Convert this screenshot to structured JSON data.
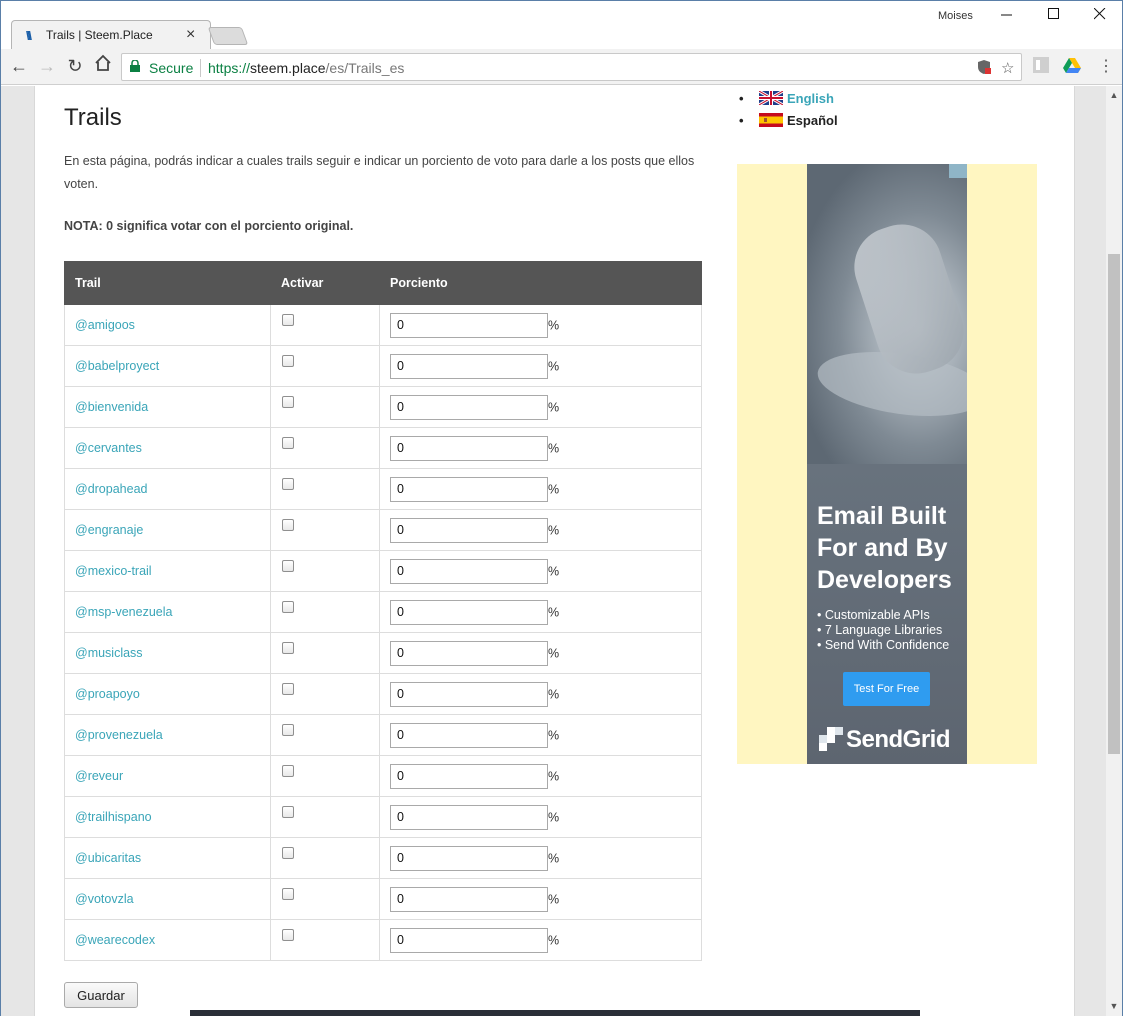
{
  "browser": {
    "tab_title": "Trails | Steem.Place",
    "tab_favicon": "\\\\\\",
    "profile_name": "Moises",
    "secure_label": "Secure",
    "url_scheme": "https://",
    "url_host": "steem.place",
    "url_path": "/es/Trails_es",
    "window_controls": [
      "minimize-icon",
      "maximize-icon",
      "close-icon"
    ]
  },
  "page": {
    "title": "Trails",
    "intro": "En esta página, podrás indicar a cuales trails seguir e indicar un porciento de voto para darle a los posts que ellos voten.",
    "note": "NOTA: 0 significa votar con el porciento original.",
    "table": {
      "headers": [
        "Trail",
        "Activar",
        "Porciento"
      ],
      "pct_symbol": "%",
      "rows": [
        {
          "trail": "@amigoos",
          "active": false,
          "percent": "0"
        },
        {
          "trail": "@babelproyect",
          "active": false,
          "percent": "0"
        },
        {
          "trail": "@bienvenida",
          "active": false,
          "percent": "0"
        },
        {
          "trail": "@cervantes",
          "active": false,
          "percent": "0"
        },
        {
          "trail": "@dropahead",
          "active": false,
          "percent": "0"
        },
        {
          "trail": "@engranaje",
          "active": false,
          "percent": "0"
        },
        {
          "trail": "@mexico-trail",
          "active": false,
          "percent": "0"
        },
        {
          "trail": "@msp-venezuela",
          "active": false,
          "percent": "0"
        },
        {
          "trail": "@musiclass",
          "active": false,
          "percent": "0"
        },
        {
          "trail": "@proapoyo",
          "active": false,
          "percent": "0"
        },
        {
          "trail": "@provenezuela",
          "active": false,
          "percent": "0"
        },
        {
          "trail": "@reveur",
          "active": false,
          "percent": "0"
        },
        {
          "trail": "@trailhispano",
          "active": false,
          "percent": "0"
        },
        {
          "trail": "@ubicaritas",
          "active": false,
          "percent": "0"
        },
        {
          "trail": "@votovzla",
          "active": false,
          "percent": "0"
        },
        {
          "trail": "@wearecodex",
          "active": false,
          "percent": "0"
        }
      ]
    },
    "save_label": "Guardar"
  },
  "sidebar": {
    "languages": [
      {
        "label": "English",
        "flag": "uk-flag-icon"
      },
      {
        "label": "Español",
        "flag": "spain-flag-icon"
      }
    ],
    "ad": {
      "headline": "Email Built For and By Developers",
      "bullets": [
        "• Customizable APIs",
        "• 7 Language Libraries",
        "• Send With Confidence"
      ],
      "cta": "Test For Free",
      "brand": "SendGrid"
    }
  },
  "colors": {
    "link": "#3aa5b8",
    "table_header": "#555555",
    "ad_background": "#fff6c1",
    "ad_cta": "#2f9cf0",
    "secure_green": "#0b8043"
  }
}
